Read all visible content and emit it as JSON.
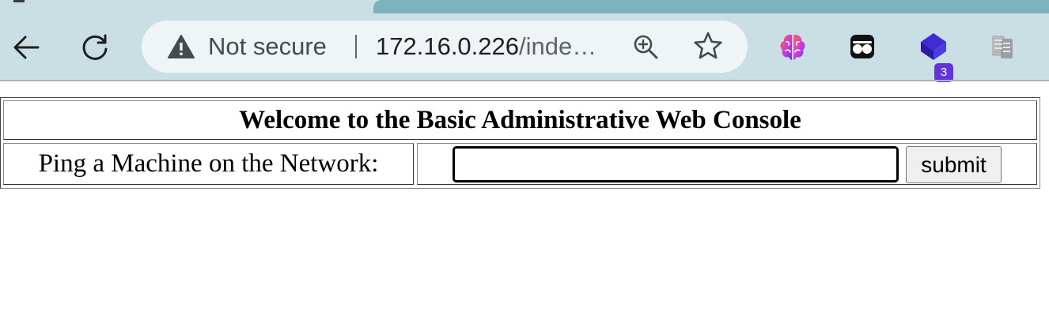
{
  "browser": {
    "omnibox": {
      "security_label": "Not secure",
      "url_host": "172.16.0.226",
      "url_path": "/inde…"
    },
    "icons": {
      "back": "back-arrow-icon",
      "reload": "reload-icon",
      "security": "warning-triangle-icon",
      "zoom": "zoom-in-icon",
      "bookmark": "star-icon"
    },
    "extensions": [
      {
        "name": "brain-extension-icon"
      },
      {
        "name": "mask-extension-icon"
      },
      {
        "name": "cube-extension-icon",
        "badge": "3"
      },
      {
        "name": "reader-extension-icon"
      }
    ],
    "colors": {
      "toolbar": "#c9dfe3",
      "inactive_tab": "#7eb3bd",
      "omnibox": "#eff5f6",
      "badge": "#6234d9"
    }
  },
  "page": {
    "title": "Welcome to the Basic Administrative Web Console",
    "ping_label": "Ping a Machine on the Network:",
    "ping_input_value": "",
    "submit_label": "submit"
  }
}
